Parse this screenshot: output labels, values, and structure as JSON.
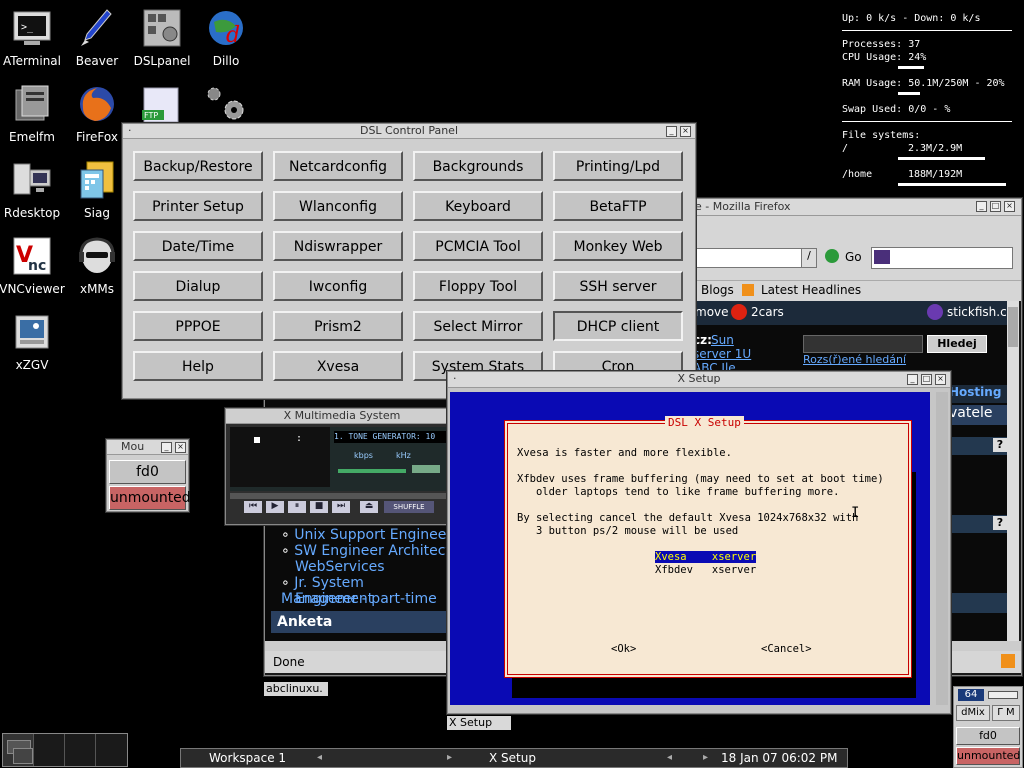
{
  "desktop_icons": [
    {
      "label": "ATerminal",
      "icon": "terminal-icon"
    },
    {
      "label": "Beaver",
      "icon": "beaver-icon"
    },
    {
      "label": "DSLpanel",
      "icon": "dsl-panel-icon"
    },
    {
      "label": "Dillo",
      "icon": "dillo-icon"
    },
    {
      "label": "Emelfm",
      "icon": "file-manager-icon"
    },
    {
      "label": "FireFox",
      "icon": "firefox-icon"
    },
    {
      "label": "Rdesktop",
      "icon": "rdesktop-icon"
    },
    {
      "label": "Siag",
      "icon": "spreadsheet-icon"
    },
    {
      "label": "VNCviewer",
      "icon": "vnc-icon"
    },
    {
      "label": "xMMs",
      "icon": "xmms-icon"
    },
    {
      "label": "xZGV",
      "icon": "image-viewer-icon"
    }
  ],
  "conky": {
    "net": "Up: 0 k/s - Down: 0 k/s",
    "processes": "Processes: 37",
    "cpu": "CPU Usage: 24%",
    "ram": "RAM Usage: 50.1M/250M - 20%",
    "swap": "Swap Used: 0/0 - %",
    "fs_header": "File systems:",
    "fs_root_name": "/",
    "fs_root_val": "2.3M/2.9M",
    "fs_home_name": "/home",
    "fs_home_val": "188M/192M",
    "cpu_level": 0.24,
    "ram_level": 0.2,
    "root_level": 0.79,
    "home_level": 0.98
  },
  "control_panel": {
    "title": "DSL Control Panel",
    "buttons": [
      "Backup/Restore",
      "Netcardconfig",
      "Backgrounds",
      "Printing/Lpd",
      "Printer Setup",
      "Wlanconfig",
      "Keyboard",
      "BetaFTP",
      "Date/Time",
      "Ndiswrapper",
      "PCMCIA Tool",
      "Monkey Web",
      "Dialup",
      "Iwconfig",
      "Floppy Tool",
      "SSH server",
      "PPPOE",
      "Prism2",
      "Select Mirror",
      "DHCP client",
      "Help",
      "Xvesa",
      "System Stats",
      "Cron"
    ]
  },
  "firefox": {
    "title": "e - Mozilla Firefox",
    "go": "Go",
    "blogs": "Blogs",
    "headlines": "Latest Headlines",
    "move": "move",
    "twocars": "2cars",
    "stickfish": "stickfish.cz",
    "cz": "cz:",
    "sun": "Sun",
    "server": "server 1U",
    "abc": "ABC Ile",
    "hledej": "Hledej",
    "rozsirene": "Rozs(ř)ené hledání",
    "hosting": "Hosting",
    "vatele": "vatele",
    "list": [
      "Unix Support Engineer",
      "SW Engineer Architect",
      "WebServices",
      "Jr. System Management",
      "Engineer - part-time"
    ],
    "anketa": "Anketa",
    "status": "Done",
    "tab_label": "abclinuxu."
  },
  "xmms": {
    "title": "X Multimedia System",
    "track": "1. TONE GENERATOR: 10",
    "kbps": "kbps",
    "khz": "kHz",
    "shuffle": "SHUFFLE",
    "time": ":"
  },
  "mount": {
    "title": "Mou",
    "device": "fd0",
    "state": "unmounted"
  },
  "xsetup": {
    "title": "X Setup",
    "dialog_title": "DSL X Setup",
    "line1": "Xvesa is faster and more flexible.",
    "line2a": "Xfbdev uses frame buffering (may need to set at boot time)",
    "line2b": "   older laptops tend to like frame buffering more.",
    "line3a": "By selecting cancel the default Xvesa 1024x768x32 with",
    "line3b": "   3 button ps/2 mouse will be used",
    "opt1": "Xvesa    xserver",
    "opt2": "Xfbdev   xserver",
    "ok": "<Ok>",
    "cancel": "<Cancel>",
    "tab": "X Setup"
  },
  "mixer": {
    "volume": "64",
    "dmix": "dMix",
    "device": "fd0",
    "state": "unmounted"
  },
  "taskbar": {
    "workspace": "Workspace 1",
    "active": "X Setup",
    "clock": "18 Jan 07 06:02 PM",
    "left_arrow": "◂",
    "right_arrow": "▸"
  },
  "colors": {
    "dialog_blue": "#0a0ab4",
    "dialog_bg": "#f7e8d3",
    "dialog_red": "#c80000",
    "unmounted": "#c86464",
    "highlight": "#ffff00"
  }
}
